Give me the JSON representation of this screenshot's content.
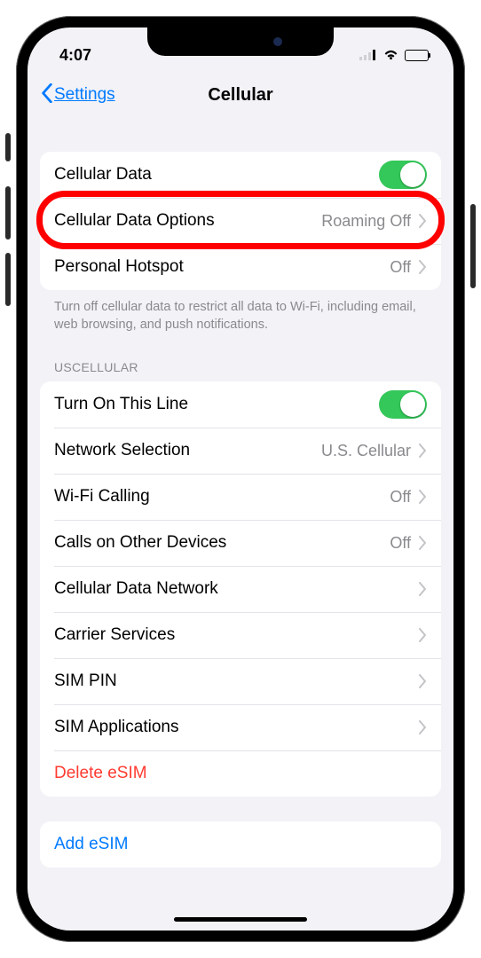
{
  "status": {
    "time": "4:07"
  },
  "nav": {
    "back_label": "Settings",
    "title": "Cellular"
  },
  "group1": {
    "cellular_data_label": "Cellular Data",
    "cellular_data_options_label": "Cellular Data Options",
    "cellular_data_options_value": "Roaming Off",
    "personal_hotspot_label": "Personal Hotspot",
    "personal_hotspot_value": "Off",
    "footer": "Turn off cellular data to restrict all data to Wi-Fi, including email, web browsing, and push notifications."
  },
  "section2_header": "USCELLULAR",
  "group2": {
    "turn_on_line_label": "Turn On This Line",
    "network_selection_label": "Network Selection",
    "network_selection_value": "U.S. Cellular",
    "wifi_calling_label": "Wi-Fi Calling",
    "wifi_calling_value": "Off",
    "calls_other_label": "Calls on Other Devices",
    "calls_other_value": "Off",
    "cell_data_net_label": "Cellular Data Network",
    "carrier_services_label": "Carrier Services",
    "sim_pin_label": "SIM PIN",
    "sim_apps_label": "SIM Applications",
    "delete_esim_label": "Delete eSIM"
  },
  "group3": {
    "add_esim_label": "Add eSIM"
  }
}
